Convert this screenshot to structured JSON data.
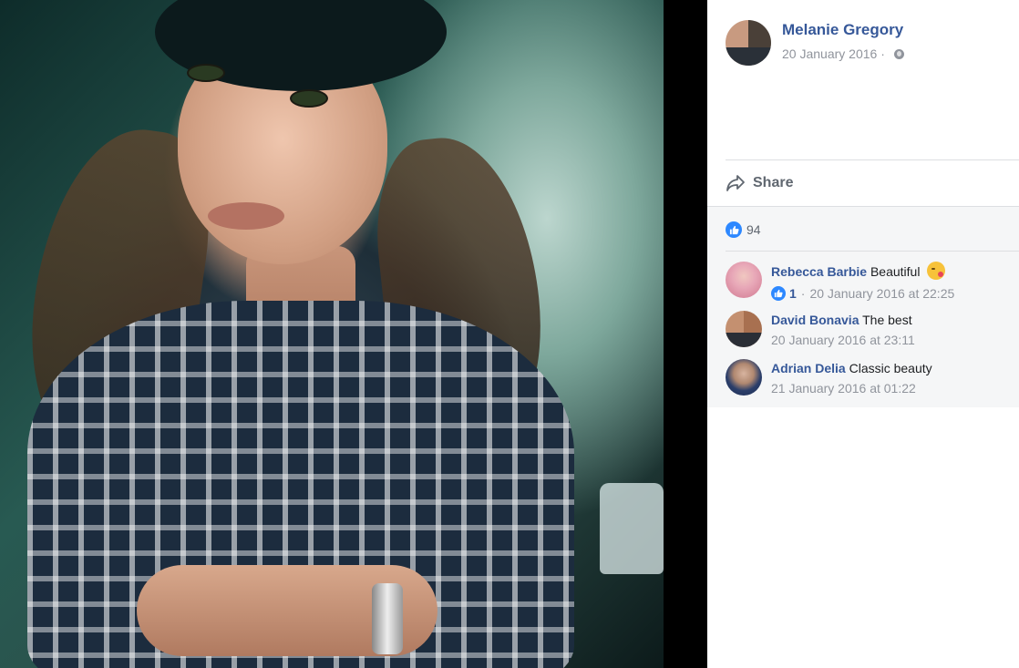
{
  "post": {
    "author": "Melanie Gregory",
    "date": "20 January 2016",
    "separator": "·",
    "privacy_icon": "globe-icon"
  },
  "actions": {
    "share_label": "Share",
    "share_icon": "share-arrow-icon"
  },
  "reactions": {
    "icon": "like-icon",
    "count": "94"
  },
  "comments": [
    {
      "author": "Rebecca Barbie",
      "text": "Beautiful",
      "emoji": "kissing-face-icon",
      "likes": "1",
      "timestamp": "20 January 2016 at 22:25"
    },
    {
      "author": "David Bonavia",
      "text": "The best",
      "timestamp": "20 January 2016 at 23:11"
    },
    {
      "author": "Adrian Delia",
      "text": "Classic beauty",
      "timestamp": "21 January 2016 at 01:22"
    }
  ],
  "colors": {
    "link": "#365899",
    "meta": "#90949c",
    "like_blue": "#2d88ff",
    "comments_bg": "#f5f6f7"
  }
}
